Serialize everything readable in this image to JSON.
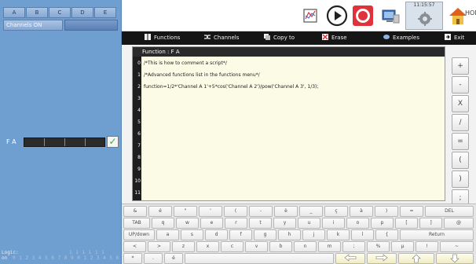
{
  "left_panel": {
    "tabs": [
      "A",
      "B",
      "C",
      "D",
      "E"
    ],
    "channels_label": "Channels ON",
    "function_label": "F A",
    "logic_label": "Logic:",
    "logic_sub": "on",
    "logic_numbers": "0 1 2 3 4 5 6 7 8 9 0 1 2 3 4 5 6",
    "logic_numbers_top": "1 1 1 1 1 1"
  },
  "toolbar": {
    "time": "11:15:57",
    "home_label": "HOM"
  },
  "menu": {
    "functions": "Functions",
    "channels": "Channels",
    "copy_to": "Copy to",
    "erase": "Erase",
    "examples": "Examples",
    "exit": "Exit"
  },
  "editor": {
    "title": "Function : F A",
    "line_numbers": [
      "0",
      "1",
      "2",
      "3",
      "4",
      "5",
      "6",
      "7",
      "8",
      "9",
      "10",
      "11"
    ],
    "code_lines": [
      "/*This is how to comment a script*/",
      "/*Advanced functions list in the functions menu*/",
      "function=1/2*'Channel A 1'+5*cos('Channel A 2')/pow('Channel A 3', 1/3);",
      "",
      "",
      "",
      "",
      "",
      "",
      "",
      "",
      ""
    ]
  },
  "side_keys": [
    "+",
    "-",
    "X",
    "/",
    "=",
    "(",
    ")",
    ";"
  ],
  "keyboard": {
    "row1": [
      "&",
      "é",
      "\"",
      "'",
      "(",
      "-",
      "è",
      "_",
      "ç",
      "à",
      ")",
      "=",
      "DEL"
    ],
    "row2": [
      "TAB",
      "q",
      "w",
      "e",
      "r",
      "t",
      "y",
      "u",
      "i",
      "o",
      "p",
      "[",
      "]",
      "@"
    ],
    "row3": [
      "UP/down",
      "a",
      "s",
      "d",
      "f",
      "g",
      "h",
      "j",
      "k",
      "l",
      "{",
      "Return"
    ],
    "row4": [
      "<",
      ">",
      "z",
      "x",
      "c",
      "v",
      "b",
      "n",
      "m",
      ";",
      "%",
      "µ",
      "!",
      "~"
    ],
    "row5": [
      "*",
      ".",
      "é"
    ]
  },
  "colors": {
    "left_panel_bg": "#6f9fd0",
    "menu_bg": "#151515",
    "editor_bg": "#fcfbe5",
    "accent_red": "#e0323b"
  }
}
